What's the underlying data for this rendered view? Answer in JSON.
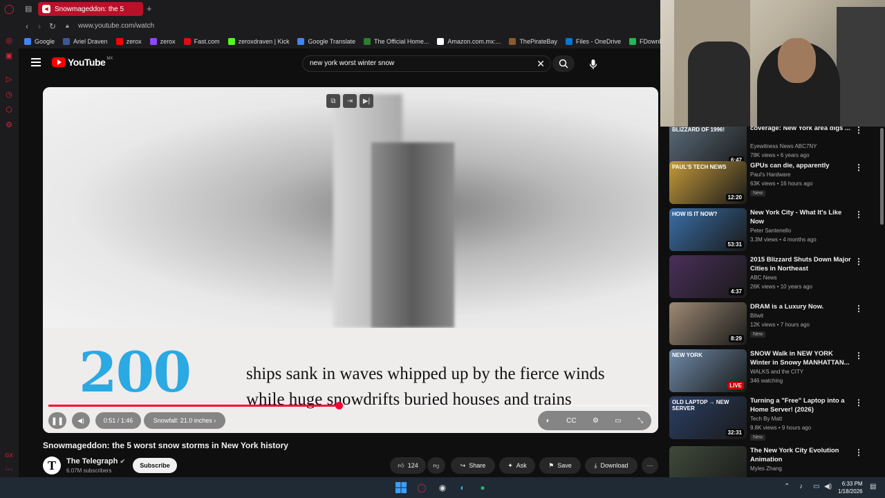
{
  "browser": {
    "tab_title": "Snowmageddon: the 5",
    "url": "www.youtube.com/watch",
    "bookmarks": [
      {
        "label": "Google",
        "color": "#4285f4"
      },
      {
        "label": "Ariel Draven",
        "color": "#3b5998"
      },
      {
        "label": "zerox",
        "color": "#ff0000"
      },
      {
        "label": "zerox",
        "color": "#9146ff"
      },
      {
        "label": "Fast.com",
        "color": "#e50914"
      },
      {
        "label": "zeroxdraven | Kick",
        "color": "#53fc18"
      },
      {
        "label": "Google Translate",
        "color": "#4285f4"
      },
      {
        "label": "The Official Home...",
        "color": "#2e7d32"
      },
      {
        "label": "Amazon.com.mx:...",
        "color": "#ffffff"
      },
      {
        "label": "ThePirateBay",
        "color": "#8b5a2b"
      },
      {
        "label": "Files - OneDrive",
        "color": "#0078d4"
      },
      {
        "label": "FDownloader - Do...",
        "color": "#1db954"
      }
    ]
  },
  "youtube": {
    "logo_text": "YouTube",
    "country_code": "MX",
    "search_value": "new york worst winter snow"
  },
  "player": {
    "big_number": "200",
    "caption_line1": "ships sank in waves whipped up by the fierce winds",
    "caption_line2": "while huge snowdrifts buried houses and trains",
    "time": "0:51 / 1:46",
    "chapter": "Snowfall: 21.0 inches",
    "progress_fraction": 0.48
  },
  "video": {
    "title": "Snowmageddon: the 5 worst snow storms in New York history",
    "channel": "The Telegraph",
    "subscribers": "6.07M subscribers",
    "subscribe_label": "Subscribe",
    "likes": "124",
    "share_label": "Share",
    "ask_label": "Ask",
    "save_label": "Save",
    "download_label": "Download"
  },
  "recommendations": [
    {
      "title": "coverage: New York area digs ...",
      "channel": "Eyewitness News ABC7NY",
      "meta": "78K views • 6 years ago",
      "duration": "6:47",
      "badge": "",
      "overlay": "BLIZZARD OF 1996!",
      "thumb": "#5a6b7a"
    },
    {
      "title": "GPUs can die, apparently",
      "channel": "Paul's Hardware",
      "meta": "63K views • 16 hours ago",
      "duration": "12:20",
      "badge": "New",
      "overlay": "PAUL'S TECH NEWS",
      "thumb": "#c49a3a"
    },
    {
      "title": "New York City - What It's Like Now",
      "channel": "Peter Santenello",
      "meta": "3.3M views • 4 months ago",
      "duration": "53:31",
      "badge": "",
      "overlay": "HOW IS IT NOW?",
      "thumb": "#3a6fa8"
    },
    {
      "title": "2015 Blizzard Shuts Down Major Cities in Northeast",
      "channel": "ABC News",
      "meta": "26K views • 10 years ago",
      "duration": "4:37",
      "badge": "",
      "overlay": "",
      "thumb": "#4a2f5a"
    },
    {
      "title": "DRAM is a Luxury Now.",
      "channel": "Bitwit",
      "meta": "12K views • 7 hours ago",
      "duration": "8:29",
      "badge": "New",
      "overlay": "",
      "thumb": "#9e8a74"
    },
    {
      "title": "SNOW Walk in NEW YORK Winter in Snowy MANHATTAN...",
      "channel": "WALKS and the CITY",
      "meta": "346 watching",
      "duration": "LIVE",
      "badge": "",
      "overlay": "NEW YORK",
      "thumb": "#6f8aa8"
    },
    {
      "title": "Turning a \"Free\" Laptop into a Home Server! (2026)",
      "channel": "Tech By Matt",
      "meta": "9.8K views • 9 hours ago",
      "duration": "32:31",
      "badge": "New",
      "overlay": "OLD LAPTOP → NEW SERVER",
      "thumb": "#2b3f66"
    },
    {
      "title": "The New York City Evolution Animation",
      "channel": "Myles Zhang",
      "meta": "",
      "duration": "",
      "badge": "",
      "overlay": "",
      "thumb": "#3f4a3a"
    }
  ],
  "taskbar": {
    "time": "6:33 PM",
    "date": "1/18/2026"
  },
  "colors": {
    "accent": "#ff0033",
    "opera": "#e0223a",
    "caption_number": "#2aa9e2"
  }
}
